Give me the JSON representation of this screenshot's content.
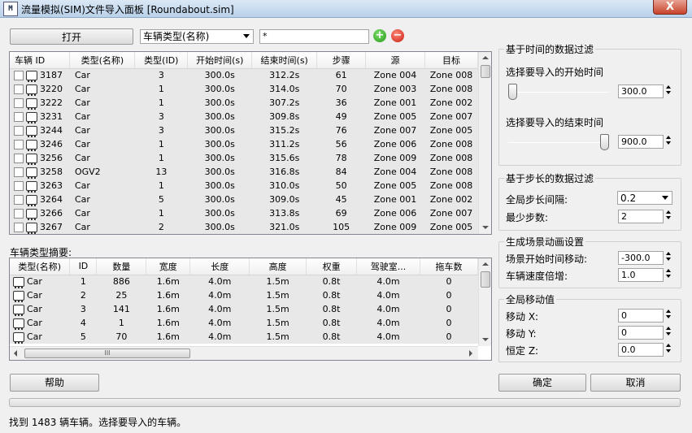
{
  "window": {
    "title": "流量模拟(SIM)文件导入面板 [Roundabout.sim]",
    "close_glyph": "X",
    "app_icon": "M"
  },
  "top": {
    "open_label": "打开",
    "filter_field": "车辆类型(名称)",
    "filter_value": "*",
    "add_icon": "plus-icon",
    "remove_icon": "minus-icon"
  },
  "vehicle_table": {
    "headers": [
      "车辆 ID",
      "类型(名称)",
      "类型(ID)",
      "开始时间(s)",
      "结束时间(s)",
      "步骤",
      "源",
      "目标"
    ],
    "rows": [
      [
        "3187",
        "Car",
        "3",
        "300.0s",
        "312.2s",
        "61",
        "Zone 004",
        "Zone 008"
      ],
      [
        "3220",
        "Car",
        "1",
        "300.0s",
        "314.0s",
        "70",
        "Zone 003",
        "Zone 008"
      ],
      [
        "3222",
        "Car",
        "1",
        "300.0s",
        "307.2s",
        "36",
        "Zone 001",
        "Zone 002"
      ],
      [
        "3231",
        "Car",
        "3",
        "300.0s",
        "309.8s",
        "49",
        "Zone 005",
        "Zone 007"
      ],
      [
        "3244",
        "Car",
        "3",
        "300.0s",
        "315.2s",
        "76",
        "Zone 007",
        "Zone 005"
      ],
      [
        "3246",
        "Car",
        "1",
        "300.0s",
        "311.2s",
        "56",
        "Zone 006",
        "Zone 008"
      ],
      [
        "3256",
        "Car",
        "1",
        "300.0s",
        "315.6s",
        "78",
        "Zone 009",
        "Zone 008"
      ],
      [
        "3258",
        "OGV2",
        "13",
        "300.0s",
        "316.8s",
        "84",
        "Zone 004",
        "Zone 008"
      ],
      [
        "3263",
        "Car",
        "1",
        "300.0s",
        "310.0s",
        "50",
        "Zone 005",
        "Zone 008"
      ],
      [
        "3264",
        "Car",
        "5",
        "300.0s",
        "309.0s",
        "45",
        "Zone 001",
        "Zone 002"
      ],
      [
        "3266",
        "Car",
        "1",
        "300.0s",
        "313.8s",
        "69",
        "Zone 006",
        "Zone 007"
      ],
      [
        "3267",
        "Car",
        "2",
        "300.0s",
        "321.0s",
        "105",
        "Zone 009",
        "Zone 005"
      ]
    ]
  },
  "summary": {
    "label": "车辆类型摘要:",
    "headers": [
      "类型(名称)",
      "ID",
      "数量",
      "宽度",
      "长度",
      "高度",
      "权重",
      "驾驶室...",
      "拖车数"
    ],
    "rows": [
      [
        "Car",
        "1",
        "886",
        "1.6m",
        "4.0m",
        "1.5m",
        "0.8t",
        "4.0m",
        "0"
      ],
      [
        "Car",
        "2",
        "25",
        "1.6m",
        "4.0m",
        "1.5m",
        "0.8t",
        "4.0m",
        "0"
      ],
      [
        "Car",
        "3",
        "141",
        "1.6m",
        "4.0m",
        "1.5m",
        "0.8t",
        "4.0m",
        "0"
      ],
      [
        "Car",
        "4",
        "1",
        "1.6m",
        "4.0m",
        "1.5m",
        "0.8t",
        "4.0m",
        "0"
      ],
      [
        "Car",
        "5",
        "70",
        "1.6m",
        "4.0m",
        "1.5m",
        "0.8t",
        "4.0m",
        "0"
      ]
    ],
    "hscroll_grip": "III"
  },
  "time_filter": {
    "title": "基于时间的数据过滤",
    "start_label": "选择要导入的开始时间",
    "start_value": "300.0",
    "start_fraction": 0.0,
    "end_label": "选择要导入的结束时间",
    "end_value": "900.0",
    "end_fraction": 1.0
  },
  "step_filter": {
    "title": "基于步长的数据过滤",
    "global_step_label": "全局步长间隔:",
    "global_step_value": "0.2",
    "min_steps_label": "最少步数:",
    "min_steps_value": "2"
  },
  "animation": {
    "title": "生成场景动画设置",
    "offset_label": "场景开始时间移动:",
    "offset_value": "-300.0",
    "speed_label": "车辆速度倍增:",
    "speed_value": "1.0"
  },
  "offset": {
    "title": "全局移动值",
    "x_label": "移动 X:",
    "x_value": "0",
    "y_label": "移动 Y:",
    "y_value": "0",
    "z_label": "恒定 Z:",
    "z_value": "0.0"
  },
  "bottom": {
    "help_label": "帮助",
    "ok_label": "确定",
    "cancel_label": "取消",
    "status": "找到 1483 辆车辆。选择要导入的车辆。"
  }
}
